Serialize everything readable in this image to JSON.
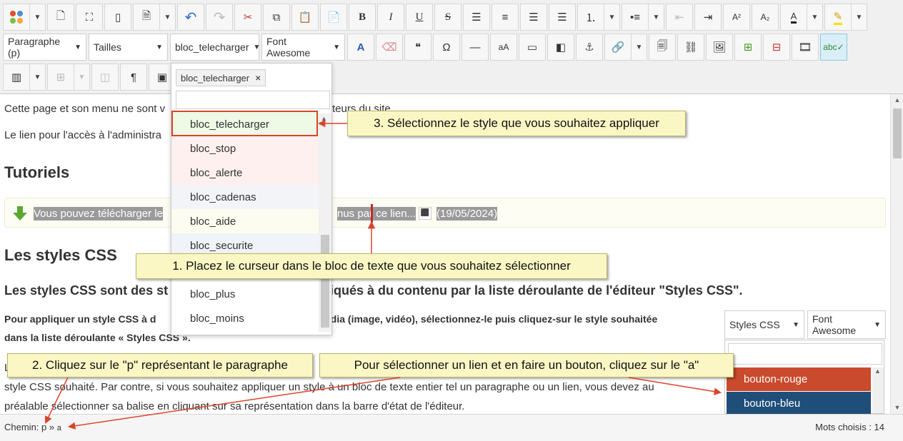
{
  "toolbar": {
    "format_select": "Paragraphe (p)",
    "size_select": "Tailles",
    "style_select": "bloc_telecharger",
    "fontawesome_select": "Font Awesome",
    "bold": "B",
    "italic": "I",
    "underline": "U",
    "strike": "S",
    "superscript": "A²",
    "subscript": "A₂",
    "text_color": "A",
    "pilcrow": "¶",
    "omega": "Ω",
    "quote": "❝",
    "undo": "↶",
    "redo": "↷",
    "cut": "✂"
  },
  "content": {
    "line1": "Cette page et son menu ne sont v",
    "line1_end": "teurs du site...",
    "line2": "Le lien pour l'accès à l'administra",
    "heading_tutoriels": "Tutoriels",
    "download_text_a": "Vous pouvez télécharger le",
    "download_text_b": "nus par ce lien...",
    "download_date": "(19/05/2024)",
    "heading_styles": "Les styles CSS",
    "subheading_a": "Les styles CSS sont des st",
    "subheading_b": "liqués à du contenu par la liste déroulante de l'éditeur \"Styles CSS\".",
    "para_a1": "Pour appliquer un style CSS à d",
    "para_a2": "édia (image, vidéo), sélectionnez-le puis cliquez-sur le style souhaitée",
    "para_a3": "dans la liste déroulante « Styles CSS ».",
    "para_b1": "L",
    "para_b2": "style CSS souhaité. Par contre, si vous souhaitez appliquer un style à un bloc de texte entier tel un paragraphe ou un lien, vous devez au",
    "para_b3": "préalable sélectionner sa balise en cliquant sur sa représentation dans la barre d'état de l'éditeur."
  },
  "dropdown": {
    "tag": "bloc_telecharger",
    "tag_remove": "×",
    "search_value": "",
    "options": [
      {
        "label": "bloc_telecharger",
        "bg": "#eef9e6"
      },
      {
        "label": "bloc_stop",
        "bg": "#fdf0ee"
      },
      {
        "label": "bloc_alerte",
        "bg": "#fdf0ee"
      },
      {
        "label": "bloc_cadenas",
        "bg": "#f2f4f7"
      },
      {
        "label": "bloc_aide",
        "bg": "#fcfdf0"
      },
      {
        "label": "bloc_securite",
        "bg": "#f0f3f7"
      },
      {
        "label": "",
        "bg": "#ffffff"
      },
      {
        "label": "bloc_plus",
        "bg": "#ffffff"
      },
      {
        "label": "bloc_moins",
        "bg": "#ffffff"
      }
    ]
  },
  "mini": {
    "styles_select": "Styles CSS",
    "fa_select": "Font Awesome",
    "search_value": "",
    "options": [
      {
        "label": "bouton-rouge",
        "bg": "#c94a2c"
      },
      {
        "label": "bouton-bleu",
        "bg": "#1f4e79"
      }
    ]
  },
  "callouts": {
    "step1": "1. Placez le curseur dans le bloc de texte que vous souhaitez sélectionner",
    "step2": "2. Cliquez sur le \"p\" représentant le paragraphe",
    "step3": "3. Sélectionnez le style que vous souhaitez appliquer",
    "link_tip": "Pour sélectionner un lien et en faire un bouton, cliquez sur le \"a\""
  },
  "status": {
    "path_label": "Chemin:",
    "path_p": "p",
    "path_sep": "»",
    "path_a": "a",
    "word_count": "Mots choisis : 14"
  },
  "colors": {
    "accent_red": "#d9452b",
    "callout_bg": "#fbf7c4",
    "download_arrow": "#5aa832"
  }
}
